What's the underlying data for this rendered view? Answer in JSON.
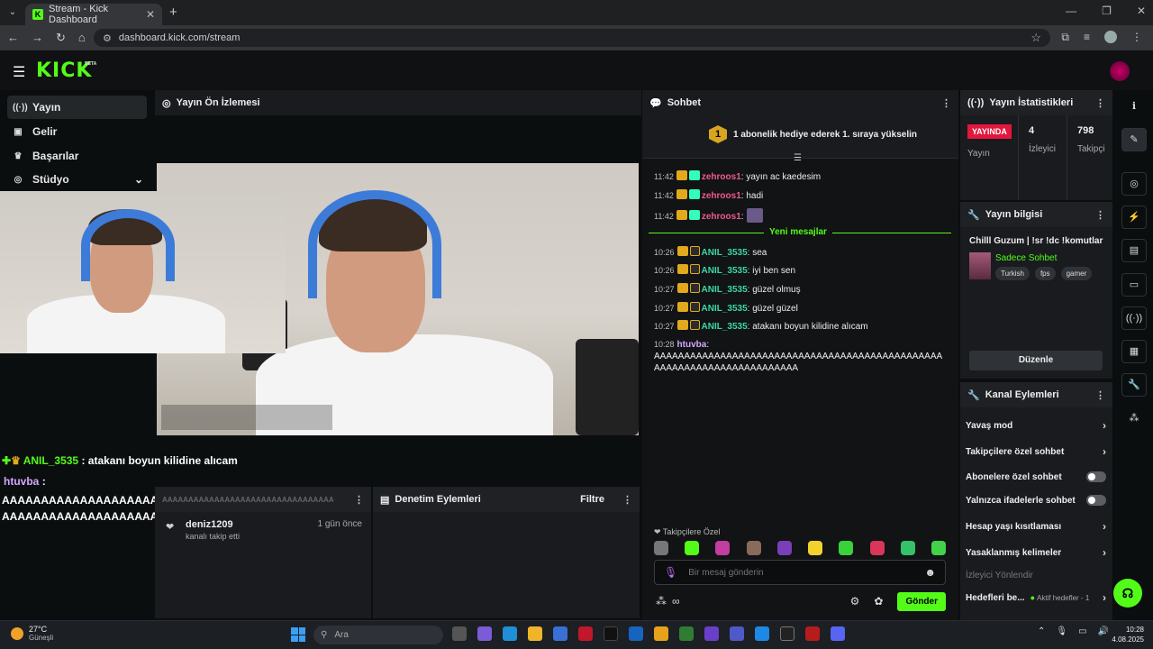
{
  "browser": {
    "tab_title": "Stream - Kick Dashboard",
    "url": "dashboard.kick.com/stream"
  },
  "header": {
    "logo": "KICK",
    "beta": "BETA"
  },
  "sidebar": {
    "items": [
      {
        "label": "Yayın",
        "icon": "broadcast-icon"
      },
      {
        "label": "Gelir",
        "icon": "revenue-icon"
      },
      {
        "label": "Başarılar",
        "icon": "trophy-icon"
      },
      {
        "label": "Stüdyo",
        "icon": "studio-icon"
      }
    ]
  },
  "preview": {
    "title": "Yayın Ön İzlemesi",
    "overlay": {
      "user1": "ANIL_3535",
      "text1": ": atakanı boyun kilidine alıcam",
      "user2": "htuvba",
      "text2_sep": ":",
      "text2": "AAAAAAAAAAAAAAAAAAAAAAAAAAAAAAAAAAAAAAAAAAAAAAAAAAAAAAAAAAAAAAAAAAAAAAAA"
    }
  },
  "activity": {
    "title": "AAAAAAAAAAAAAAAAAAAAAAAAAAAAAAAAAAAAAAAA",
    "item": {
      "user": "deniz1209",
      "ago": "1 gün önce",
      "action": "kanalı takip etti"
    }
  },
  "moderation": {
    "title": "Denetim Eylemleri",
    "filter": "Filtre"
  },
  "chat": {
    "title": "Sohbet",
    "gift_badge": "1",
    "gift_text": "1 abonelik hediye ederek 1. sıraya yükselin",
    "new_messages": "Yeni mesajlar",
    "messages_old": [
      {
        "time": "11:42",
        "user": "zehroos1",
        "text": ": yayın ac kaedesim"
      },
      {
        "time": "11:42",
        "user": "zehroos1",
        "text": ": hadi"
      },
      {
        "time": "11:42",
        "user": "zehroos1",
        "text": ":"
      }
    ],
    "messages_new": [
      {
        "time": "10:26",
        "user": "ANIL_3535",
        "text": ": sea"
      },
      {
        "time": "10:26",
        "user": "ANIL_3535",
        "text": ": iyi ben sen"
      },
      {
        "time": "10:27",
        "user": "ANIL_3535",
        "text": ": güzel olmuş"
      },
      {
        "time": "10:27",
        "user": "ANIL_3535",
        "text": ": güzel güzel"
      },
      {
        "time": "10:27",
        "user": "ANIL_3535",
        "text": ": atakanı boyun kilidine alıcam"
      }
    ],
    "long_msg": {
      "time": "10:28",
      "user": "htuvba",
      "text": "AAAAAAAAAAAAAAAAAAAAAAAAAAAAAAAAAAAAAAAAAAAAAAAAAAAAAAAAAAAAAAAAAAAAAAAA"
    },
    "followers_only": "Takipçilere Özel",
    "input_placeholder": "Bir mesaj gönderin",
    "send": "Gönder"
  },
  "stats": {
    "title": "Yayın İstatistikleri",
    "live": "YAYINDA",
    "live_label": "Yayın",
    "viewers": "4",
    "viewers_label": "İzleyici",
    "followers": "798",
    "followers_label": "Takipçi"
  },
  "info": {
    "title": "Yayın bilgisi",
    "stream_title": "Chilll Guzum | !sr !dc !komutlar",
    "category": "Sadece Sohbet",
    "tags": [
      "Turkish",
      "fps",
      "gamer"
    ],
    "edit": "Düzenle"
  },
  "actions": {
    "title": "Kanal Eylemleri",
    "rows": [
      {
        "label": "Yavaş mod",
        "kind": "chevron"
      },
      {
        "label": "Takipçilere özel sohbet",
        "kind": "chevron"
      },
      {
        "label": "Abonelere özel sohbet",
        "kind": "toggle"
      },
      {
        "label": "Yalnızca ifadelerle sohbet",
        "kind": "toggle"
      },
      {
        "label": "Hesap yaşı kısıtlaması",
        "kind": "chevron"
      },
      {
        "label": "Yasaklanmış kelimeler",
        "kind": "chevron"
      },
      {
        "label": "İzleyici Yönlendir",
        "kind": "dim"
      }
    ],
    "goals": "Hedefleri be...",
    "goals_active": "Aktif hedefler - 1"
  },
  "taskbar": {
    "temp": "27°C",
    "weather": "Güneşli",
    "search": "Ara",
    "time": "10:28",
    "date": "4.08.2025"
  },
  "colors": {
    "accent": "#53fc18",
    "live": "#e3173e",
    "panel": "#191b1f"
  }
}
